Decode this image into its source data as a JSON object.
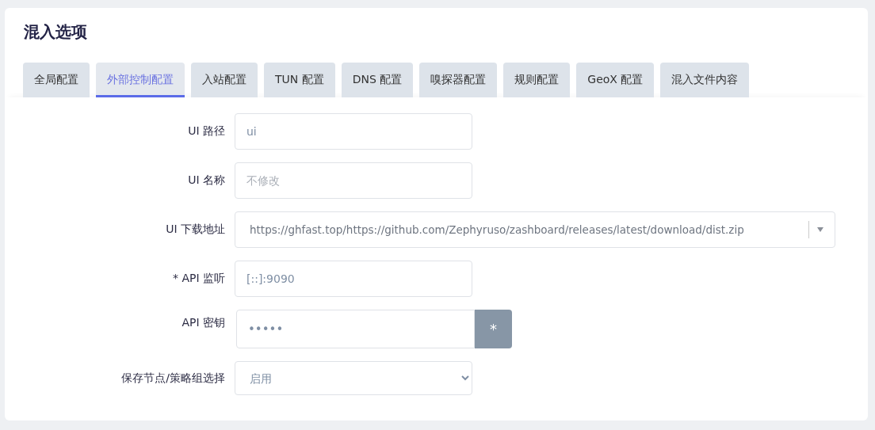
{
  "title": "混入选项",
  "tabs": [
    {
      "label": "全局配置",
      "selected": false
    },
    {
      "label": "外部控制配置",
      "selected": true
    },
    {
      "label": "入站配置",
      "selected": false
    },
    {
      "label": "TUN 配置",
      "selected": false
    },
    {
      "label": "DNS 配置",
      "selected": false
    },
    {
      "label": "嗅探器配置",
      "selected": false
    },
    {
      "label": "规则配置",
      "selected": false
    },
    {
      "label": "GeoX 配置",
      "selected": false
    },
    {
      "label": "混入文件内容",
      "selected": false
    }
  ],
  "fields": [
    {
      "kind": "text",
      "label": "UI 路径",
      "value": "ui"
    },
    {
      "kind": "text",
      "label": "UI 名称",
      "placeholder": "不修改"
    },
    {
      "kind": "combo",
      "label": "UI 下载地址",
      "value": "https://ghfast.top/https://github.com/Zephyruso/zashboard/releases/latest/download/dist.zip"
    },
    {
      "kind": "text",
      "label": "* API 监听",
      "value": "[::]:9090"
    },
    {
      "kind": "password",
      "label": "API 密钥",
      "value": "•••••",
      "button": "*"
    },
    {
      "kind": "select",
      "label": "保存节点/策略组选择",
      "value": "启用"
    }
  ]
}
